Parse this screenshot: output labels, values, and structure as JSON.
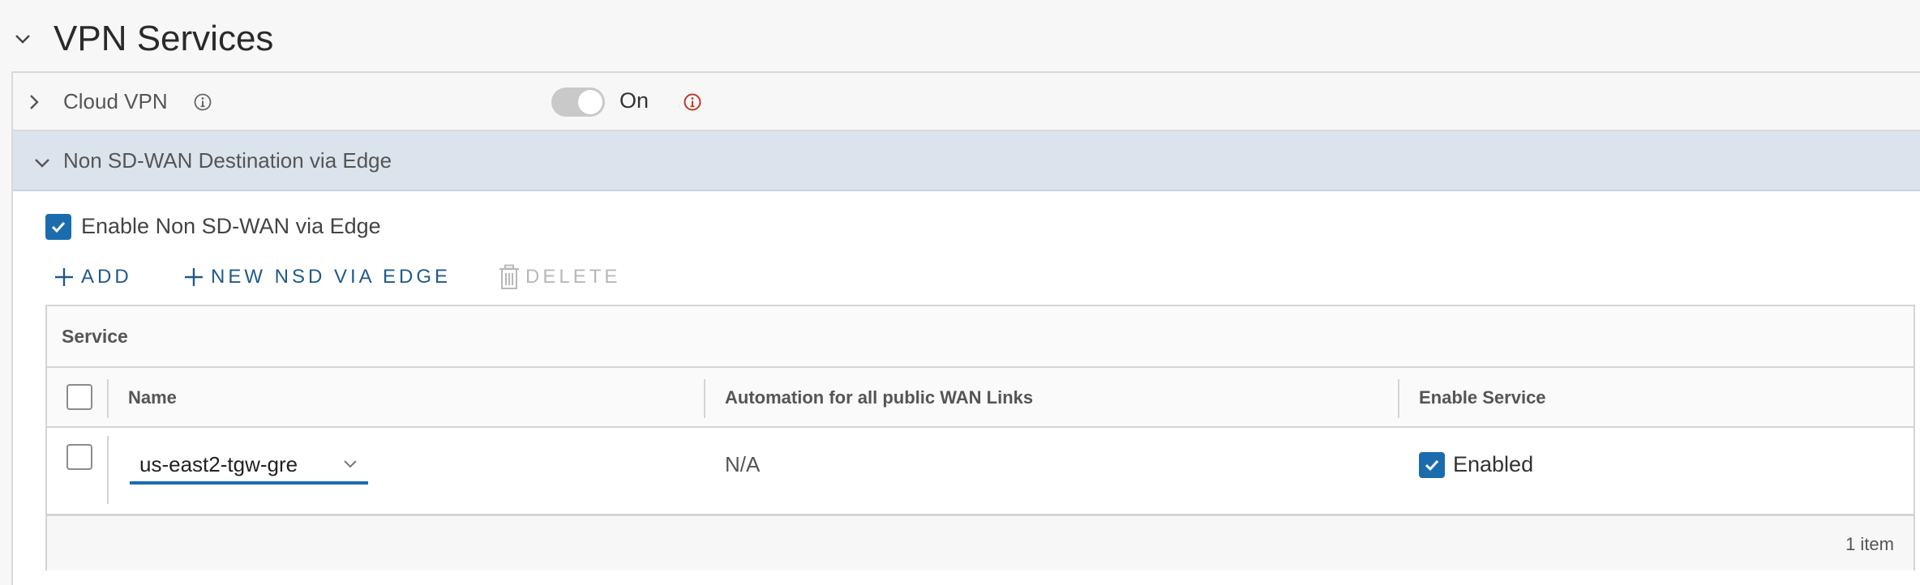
{
  "header": {
    "title": "VPN Services"
  },
  "cloud_vpn": {
    "label": "Cloud VPN",
    "toggle_state": "On"
  },
  "nsd_section": {
    "label": "Non SD-WAN Destination via Edge",
    "enable_checkbox_label": "Enable Non SD-WAN via Edge"
  },
  "toolbar": {
    "add_label": "ADD",
    "new_nsd_label": "NEW NSD VIA EDGE",
    "delete_label": "DELETE"
  },
  "grid": {
    "title": "Service",
    "columns": {
      "name": "Name",
      "automation": "Automation for all public WAN Links",
      "enable": "Enable Service"
    },
    "rows": [
      {
        "name": "us-east2-tgw-gre",
        "automation": "N/A",
        "enable": "Enabled"
      }
    ],
    "footer": "1 item"
  },
  "colors": {
    "accent": "#1b6cad",
    "link": "#1f5a8a",
    "warning": "#c0392b",
    "section_bg": "#dbe4ec"
  }
}
